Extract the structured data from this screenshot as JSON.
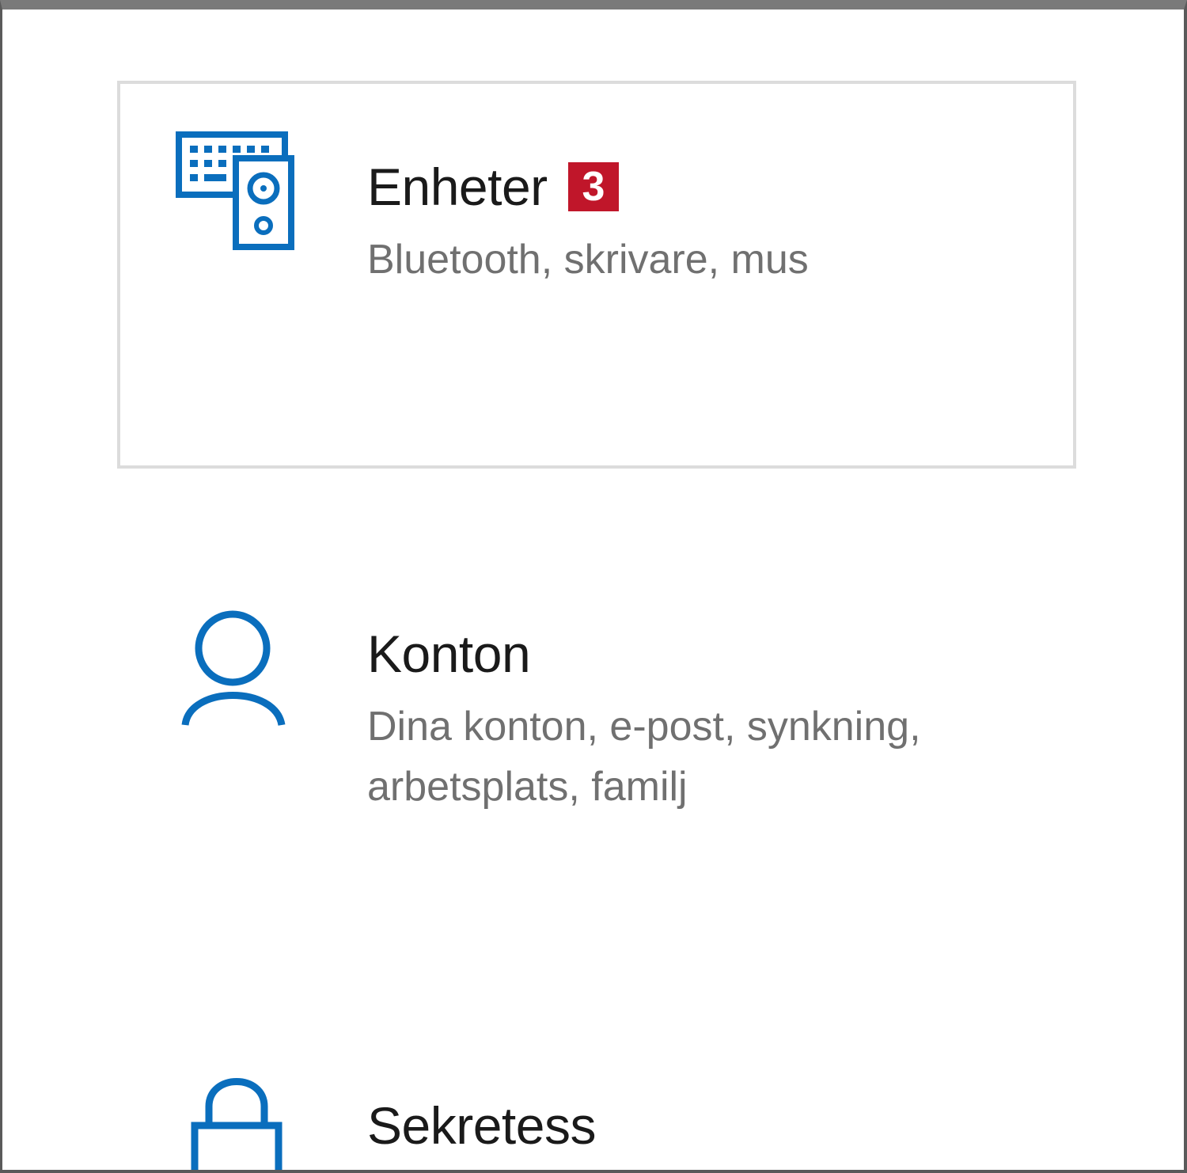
{
  "accent_color": "#0a6ebd",
  "badge_color": "#c0162a",
  "settings_tiles": [
    {
      "icon": "devices-icon",
      "title": "Enheter",
      "badge": "3",
      "description": "Bluetooth, skrivare, mus",
      "selected": true
    },
    {
      "icon": "person-icon",
      "title": "Konton",
      "description": "Dina konton, e-post, synkning, arbetsplats, familj",
      "selected": false
    },
    {
      "icon": "lock-icon",
      "title": "Sekretess",
      "description": "",
      "selected": false
    }
  ]
}
